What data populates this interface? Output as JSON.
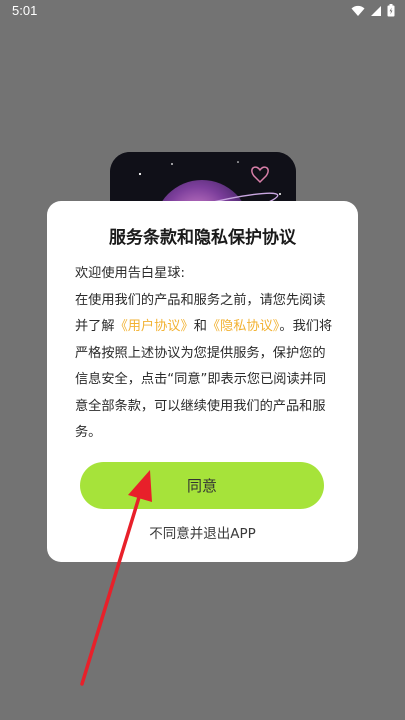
{
  "status_bar": {
    "time": "5:01"
  },
  "dialog": {
    "title": "服务条款和隐私保护协议",
    "greeting": "欢迎使用告白星球:",
    "text_part1": "在使用我们的产品和服务之前，请您先阅读并了解",
    "user_agreement_link": "《用户协议》",
    "and": "和",
    "privacy_policy_link": "《隐私协议》",
    "text_part2": "。我们将严格按照上述协议为您提供服务，保护您的信息安全，点击“同意”即表示您已阅读并同意全部条款，可以继续使用我们的产品和服务。",
    "agree_button": "同意",
    "disagree_link": "不同意并退出APP"
  },
  "colors": {
    "overlay": "#737373",
    "accent_button": "#a6e33a",
    "link": "#f2b233",
    "annotation_arrow": "#e8202a"
  },
  "icons": [
    "wifi-icon",
    "signal-icon",
    "battery-icon"
  ]
}
